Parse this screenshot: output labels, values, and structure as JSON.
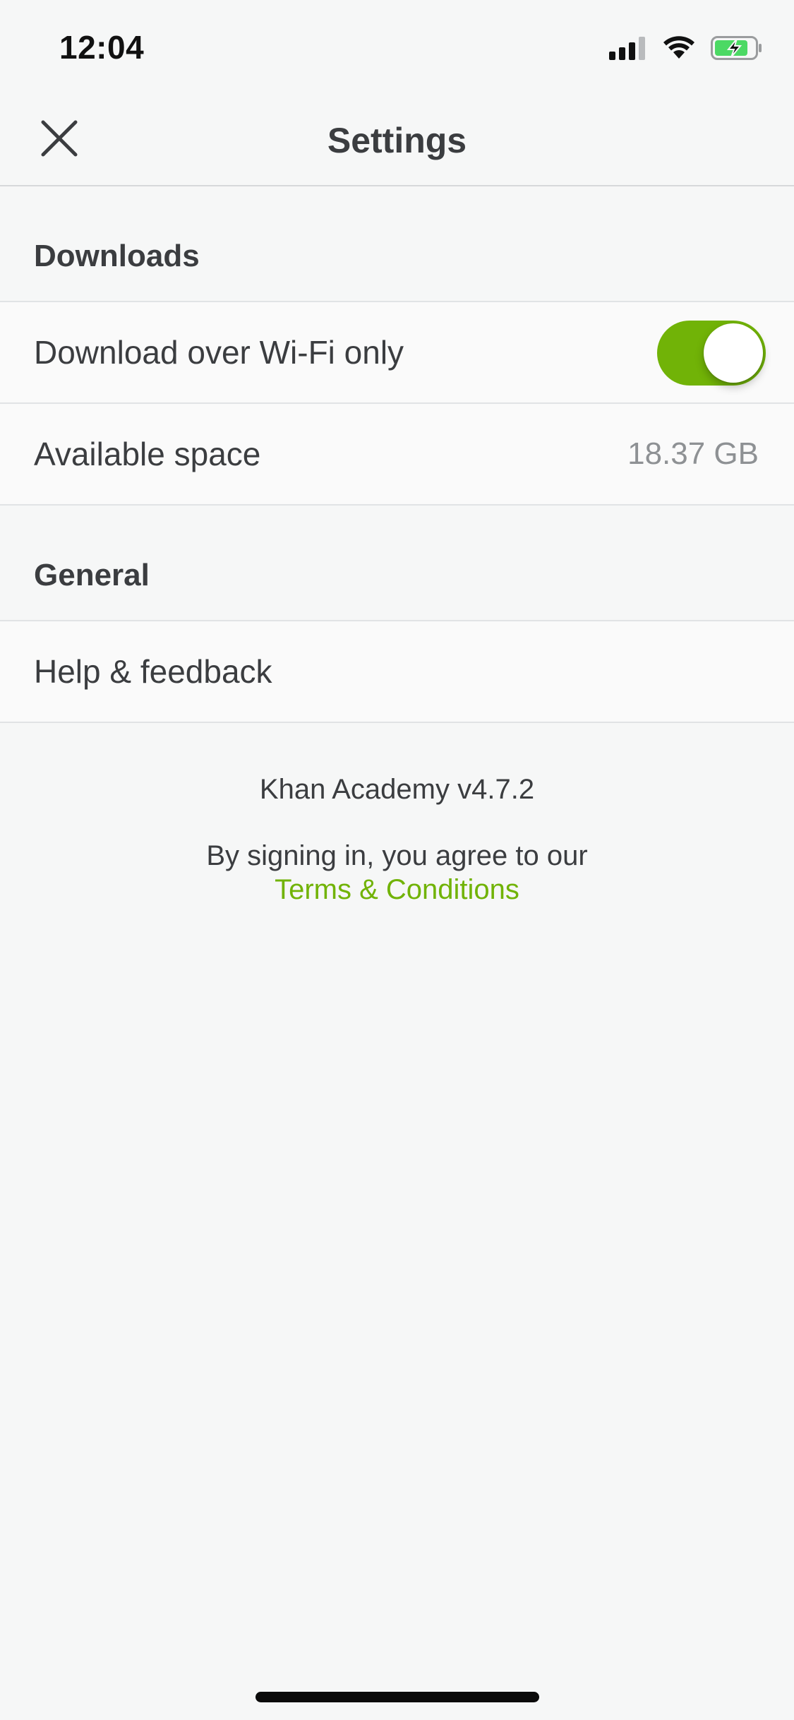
{
  "status_bar": {
    "time": "12:04",
    "icons": [
      "cellular-signal-icon",
      "wifi-icon",
      "battery-charging-icon"
    ]
  },
  "header": {
    "title": "Settings",
    "close_icon": "close-icon"
  },
  "sections": {
    "downloads": {
      "title": "Downloads",
      "wifi_only": {
        "label": "Download over Wi-Fi only",
        "enabled": true
      },
      "available_space": {
        "label": "Available space",
        "value": "18.37 GB"
      }
    },
    "general": {
      "title": "General",
      "help": {
        "label": "Help & feedback"
      }
    }
  },
  "footer": {
    "version": "Khan Academy v4.7.2",
    "agree_text": "By signing in, you agree to our",
    "terms_link": "Terms & Conditions"
  },
  "colors": {
    "accent": "#71b307",
    "background": "#f6f7f7",
    "text": "#3b3d40",
    "secondary_text": "#8e9194"
  }
}
